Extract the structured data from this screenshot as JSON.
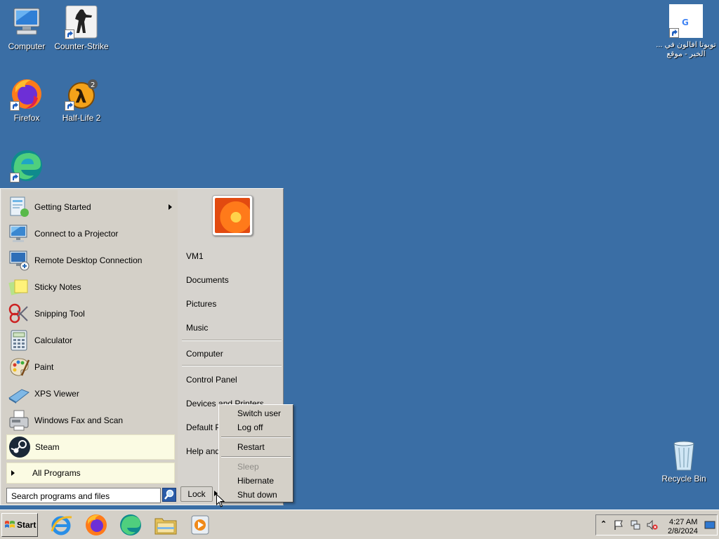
{
  "desktop": {
    "icons": [
      {
        "label": "Computer"
      },
      {
        "label": "Counter-Strike"
      },
      {
        "label": "Firefox"
      },
      {
        "label": "Half-Life 2"
      },
      {
        "label": "تويوتا افالون في ... الخير - موقع"
      },
      {
        "label": "Recycle Bin"
      }
    ]
  },
  "start_menu": {
    "programs": [
      {
        "label": "Getting Started",
        "icon": "getting-started-icon",
        "has_submenu": true
      },
      {
        "label": "Connect to a Projector",
        "icon": "projector-icon"
      },
      {
        "label": "Remote Desktop Connection",
        "icon": "remote-desktop-icon"
      },
      {
        "label": "Sticky Notes",
        "icon": "sticky-notes-icon"
      },
      {
        "label": "Snipping Tool",
        "icon": "scissors-icon"
      },
      {
        "label": "Calculator",
        "icon": "calculator-icon"
      },
      {
        "label": "Paint",
        "icon": "paint-palette-icon"
      },
      {
        "label": "XPS Viewer",
        "icon": "xps-viewer-icon"
      },
      {
        "label": "Windows Fax and Scan",
        "icon": "fax-icon"
      },
      {
        "label": "Steam",
        "icon": "steam-icon",
        "highlighted": true
      }
    ],
    "all_programs": "All Programs",
    "search_placeholder": "Search programs and files",
    "right_pane": {
      "user": "VM1",
      "items": [
        "Documents",
        "Pictures",
        "Music",
        "Computer",
        "Control Panel",
        "Devices and Printers",
        "Default P",
        "Help and"
      ]
    },
    "lock_label": "Lock"
  },
  "shutdown_menu": {
    "items": [
      {
        "label": "Switch user",
        "enabled": true
      },
      {
        "label": "Log off",
        "enabled": true
      },
      {
        "label": "Restart",
        "enabled": true
      },
      {
        "label": "Sleep",
        "enabled": false
      },
      {
        "label": "Hibernate",
        "enabled": true
      },
      {
        "label": "Shut down",
        "enabled": true
      }
    ]
  },
  "taskbar": {
    "start_label": "Start",
    "pinned": [
      "internet-explorer-icon",
      "firefox-icon",
      "edge-icon",
      "file-explorer-icon",
      "media-player-icon"
    ],
    "clock": {
      "time": "4:27 AM",
      "date": "2/8/2024"
    }
  },
  "colors": {
    "desktop": "#3a6ea5",
    "menu_bg": "#d4d0c8",
    "highlight": "#fbfbe3"
  }
}
